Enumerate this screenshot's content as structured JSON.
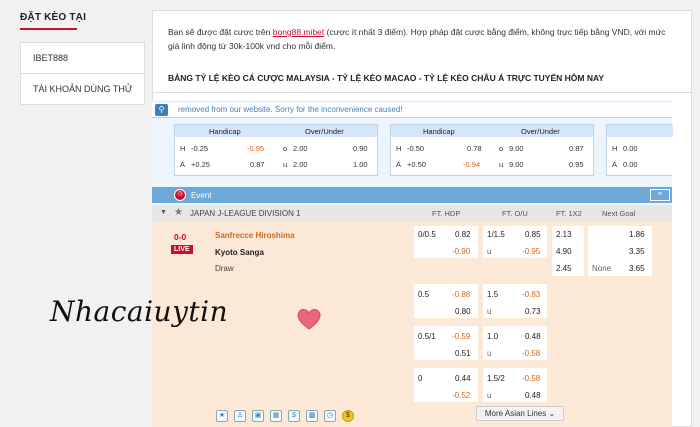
{
  "sidebar": {
    "title": "ĐẶT KÈO TẠI",
    "items": [
      {
        "label": "IBET888"
      },
      {
        "label": "TÀI KHOẢN DÙNG THỬ"
      }
    ]
  },
  "intro": {
    "before": "Bạn sẽ được đặt cược trên ",
    "link": "bong88.mibet",
    "after": " (cược ít nhất 3 điểm). Hợp pháp đặt cược bằng điểm, không trực tiếp bằng VND, với mức giá linh động từ 30k-100k vnd cho mỗi điểm."
  },
  "table_title": "BẢNG TỶ LỆ KÈO CÁ CƯỢC MALAYSIA - TỶ LỆ KÈO MACAO - TỶ LỆ KÈO CHÂU Á TRỰC TUYẾN HÔM NAY",
  "notice": "removed from our website. Sorry for the inconvenience caused!",
  "cards": [
    {
      "handicap_label": "Handicap",
      "ou_label": "Over/Under",
      "rows": [
        {
          "side": "H",
          "hdp": "-0.25",
          "hdp_odds": "-0.95",
          "ou_side": "o",
          "ou": "2.00",
          "ou_odds": "0.90"
        },
        {
          "side": "A",
          "hdp": "+0.25",
          "hdp_odds": "0.87",
          "ou_side": "u",
          "ou": "2.00",
          "ou_odds": "1.00"
        }
      ]
    },
    {
      "handicap_label": "Handicap",
      "ou_label": "Over/Under",
      "rows": [
        {
          "side": "H",
          "hdp": "-0.50",
          "hdp_odds": "0.78",
          "ou_side": "o",
          "ou": "9.00",
          "ou_odds": "0.87"
        },
        {
          "side": "A",
          "hdp": "+0.50",
          "hdp_odds": "-0.94",
          "ou_side": "u",
          "ou": "9.00",
          "ou_odds": "0.95"
        }
      ]
    },
    {
      "handicap_label": "Handicap",
      "rows": [
        {
          "side": "H",
          "hdp": "0.00"
        },
        {
          "side": "A",
          "hdp": "0.00"
        }
      ]
    }
  ],
  "event_label": "Event",
  "league": "JAPAN J-LEAGUE DIVISION 1",
  "columns": {
    "ft_hdp": "FT. HDP",
    "ft_ou": "FT. O/U",
    "ft_1x2": "FT. 1X2",
    "next_goal": "Next Goal"
  },
  "match": {
    "score": "0-0",
    "live": "LIVE",
    "home": "Sanfrecce Hiroshima",
    "away": "Kyoto Sanga",
    "draw": "Draw",
    "x12": {
      "home": "2.13",
      "away": "4.90",
      "draw": "2.45"
    },
    "next_goal": {
      "home": "1.86",
      "away": "3.35",
      "none_label": "None",
      "none": "3.65"
    },
    "lines": [
      {
        "hdp": "0/0.5",
        "hdp_home": "0.82",
        "hdp_away": "-0.90",
        "ou": "1/1.5",
        "ou_over": "0.85",
        "u_label": "u",
        "ou_under": "-0.95"
      },
      {
        "hdp": "0.5",
        "hdp_home": "-0.88",
        "hdp_away": "0.80",
        "ou": "1.5",
        "ou_over": "-0.83",
        "u_label": "u",
        "ou_under": "0.73"
      },
      {
        "hdp": "0.5/1",
        "hdp_home": "-0.59",
        "hdp_away": "0.51",
        "ou": "1.0",
        "ou_over": "0.48",
        "u_label": "u",
        "ou_under": "-0.58"
      },
      {
        "hdp": "0",
        "hdp_home": "0.44",
        "hdp_away": "-0.52",
        "ou": "1.5/2",
        "ou_over": "-0.58",
        "u_label": "u",
        "ou_under": "0.48"
      }
    ]
  },
  "more_lines": "More Asian Lines",
  "watermark": "Nhacaiuytin"
}
